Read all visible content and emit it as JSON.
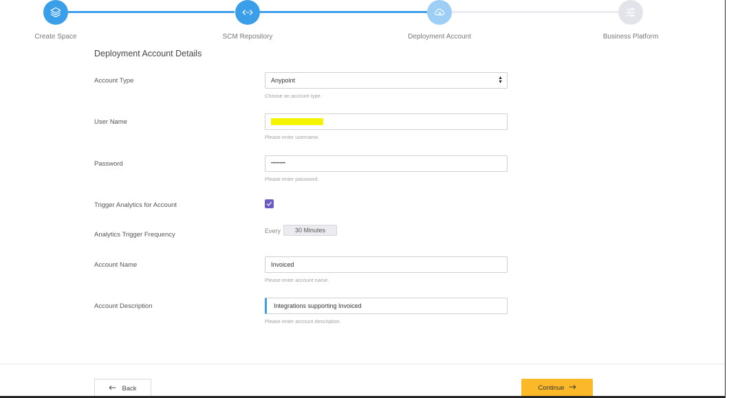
{
  "stepper": {
    "steps": [
      {
        "label": "Create Space",
        "icon": "layers-icon",
        "state": "done"
      },
      {
        "label": "SCM Repository",
        "icon": "code-arrows-icon",
        "state": "done"
      },
      {
        "label": "Deployment Account",
        "icon": "cloud-gear-icon",
        "state": "current"
      },
      {
        "label": "Business Platform",
        "icon": "sliders-icon",
        "state": "todo"
      }
    ],
    "colors": {
      "done": "#3a9ee8",
      "current": "#9dcff6",
      "todo": "#e3e4ea"
    }
  },
  "form": {
    "title": "Deployment Account Details",
    "account_type": {
      "label": "Account Type",
      "value": "Anypoint",
      "hint": "Choose an account type."
    },
    "user_name": {
      "label": "User Name",
      "value": "",
      "hint": "Please enter username."
    },
    "password": {
      "label": "Password",
      "value": "••••••••••",
      "hint": "Please enter password."
    },
    "trigger_analytics": {
      "label": "Trigger Analytics for Account",
      "checked": true
    },
    "frequency": {
      "label": "Analytics Trigger Frequency",
      "prefix": "Every",
      "value": "30 Minutes"
    },
    "account_name": {
      "label": "Account Name",
      "value": "Invoiced",
      "hint": "Please enter account name."
    },
    "account_description": {
      "label": "Account Description",
      "value": "Integrations supporting Invoiced",
      "hint": "Please enter account description."
    }
  },
  "footer": {
    "back_label": "Back",
    "continue_label": "Continue",
    "accent": "#fbb829"
  }
}
